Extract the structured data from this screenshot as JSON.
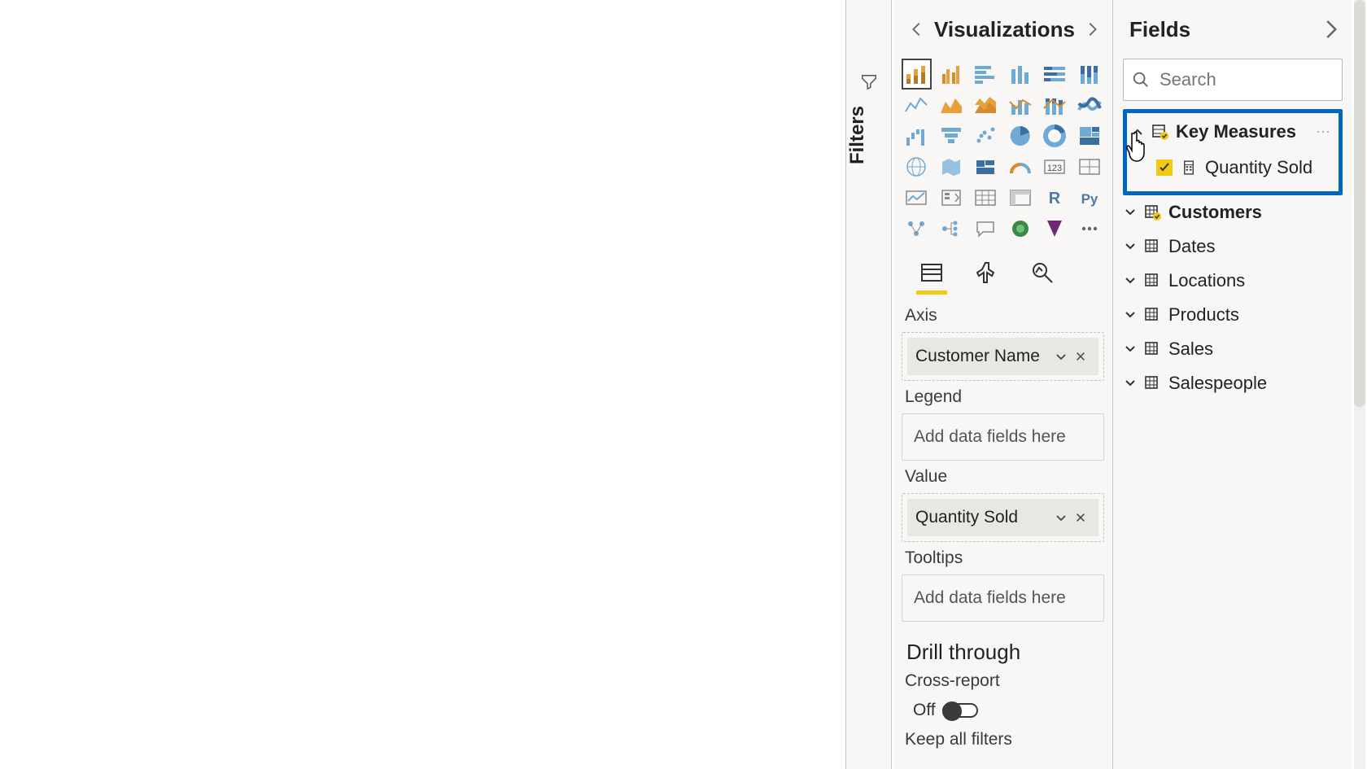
{
  "filters": {
    "label": "Filters"
  },
  "viz": {
    "title": "Visualizations",
    "icons": [
      "stacked-bar",
      "clustered-column",
      "clustered-bar",
      "stacked-column",
      "stacked-100-column",
      "stacked-100-bar",
      "line",
      "area",
      "stacked-area",
      "line-clustered",
      "line-stacked",
      "ribbon",
      "waterfall",
      "funnel",
      "scatter",
      "pie",
      "donut",
      "treemap",
      "map",
      "filled-map",
      "shape-map",
      "gauge",
      "card",
      "multi-card",
      "kpi",
      "slicer",
      "table",
      "matrix",
      "r",
      "python",
      "key-influencers",
      "decomp",
      "qna",
      "arcgis",
      "powerapps",
      "more"
    ],
    "wells": {
      "axis": {
        "label": "Axis",
        "field": "Customer Name"
      },
      "legend": {
        "label": "Legend",
        "placeholder": "Add data fields here"
      },
      "value": {
        "label": "Value",
        "field": "Quantity Sold"
      },
      "tooltips": {
        "label": "Tooltips",
        "placeholder": "Add data fields here"
      }
    },
    "drill": {
      "title": "Drill through",
      "cross_label": "Cross-report",
      "toggle_text": "Off",
      "keep_label": "Keep all filters"
    }
  },
  "fields": {
    "title": "Fields",
    "search_placeholder": "Search",
    "highlight": {
      "table": "Key Measures",
      "measure": "Quantity Sold"
    },
    "tables": [
      {
        "name": "Customers",
        "hasSelection": true
      },
      {
        "name": "Dates",
        "hasSelection": false
      },
      {
        "name": "Locations",
        "hasSelection": false
      },
      {
        "name": "Products",
        "hasSelection": false
      },
      {
        "name": "Sales",
        "hasSelection": false
      },
      {
        "name": "Salespeople",
        "hasSelection": false
      }
    ]
  }
}
